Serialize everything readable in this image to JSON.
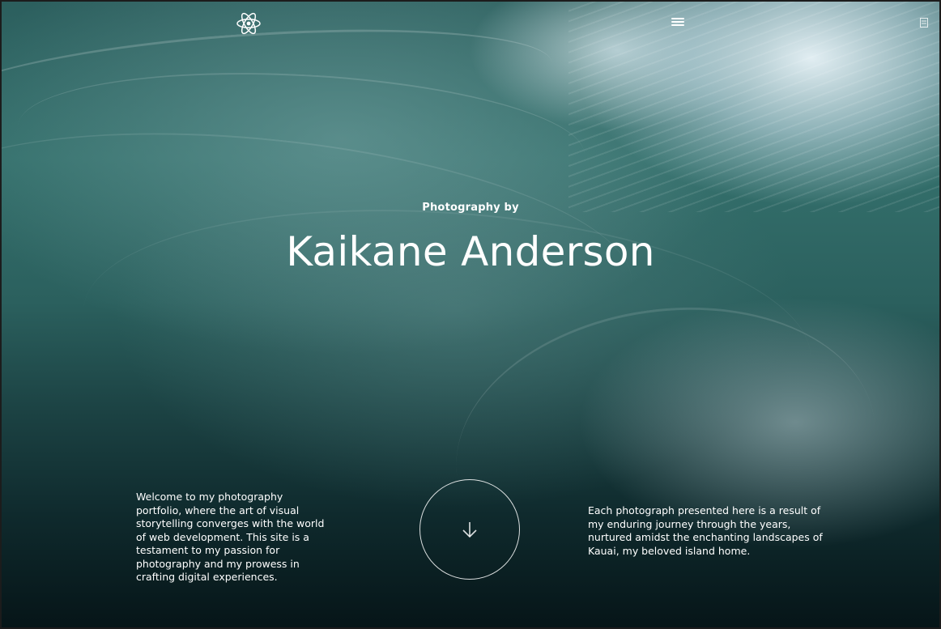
{
  "header": {
    "logo_icon": "atom-icon",
    "menu_icon": "hamburger-menu-icon"
  },
  "hero": {
    "subtitle": "Photography by",
    "title": "Kaikane Anderson",
    "left_text": "Welcome to my photography portfolio, where the art of visual storytelling converges with the world of web development. This site is a testament to my passion for photography and my prowess in crafting digital experiences.",
    "right_text": "Each photograph presented here is a result of my enduring journey through the years, nurtured amidst the enchanting landscapes of Kauai, my beloved island home.",
    "scroll_icon": "arrow-down-icon"
  },
  "colors": {
    "text": "#ffffff",
    "water_dark": "#061518",
    "water_mid": "#2b605e",
    "foam": "#e6f0f3"
  }
}
